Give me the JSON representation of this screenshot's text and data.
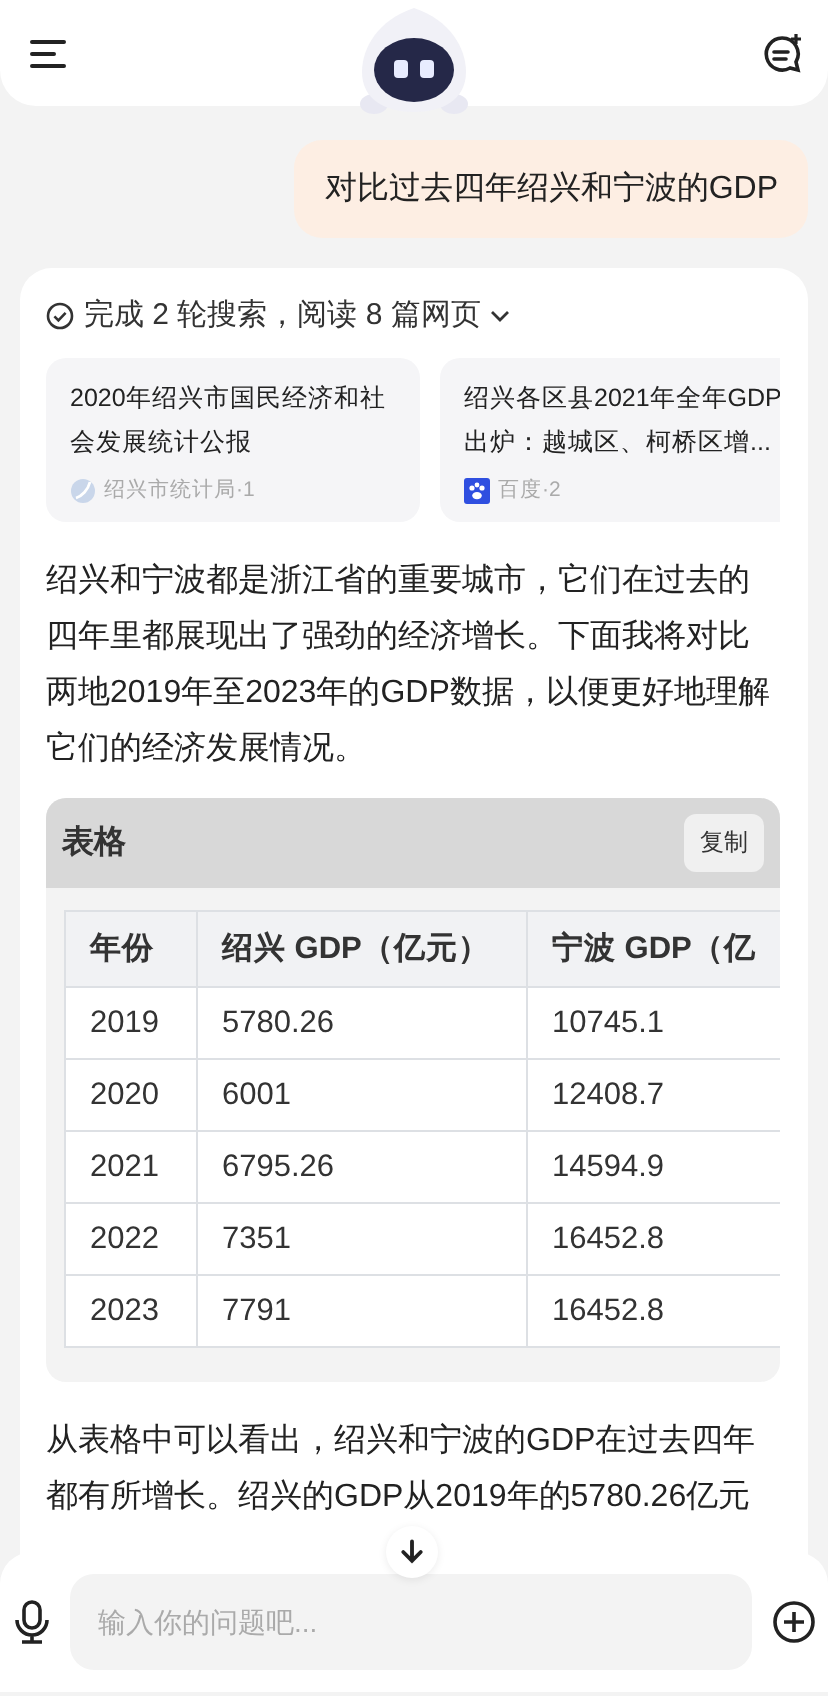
{
  "user_message": "对比过去四年绍兴和宁波的GDP",
  "answer": {
    "search_summary": "完成 2 轮搜索，阅读 8 篇网页",
    "sources": [
      {
        "title": "2020年绍兴市国民经济和社会发展统计公报",
        "source": "绍兴市统计局·1",
        "kind": "globe"
      },
      {
        "title": "绍兴各区县2021年全年GDP出炉：越城区、柯桥区增...",
        "source": "百度·2",
        "kind": "paw"
      }
    ],
    "intro": "绍兴和宁波都是浙江省的重要城市，它们在过去的四年里都展现出了强劲的经济增长。下面我将对比两地2019年至2023年的GDP数据，以便更好地理解它们的经济发展情况。",
    "table": {
      "title": "表格",
      "copy_button": "复制",
      "columns": [
        "年份",
        "绍兴 GDP（亿元）",
        "宁波 GDP（亿"
      ],
      "rows": [
        [
          "2019",
          "5780.26",
          "10745.1"
        ],
        [
          "2020",
          "6001",
          "12408.7"
        ],
        [
          "2021",
          "6795.26",
          "14594.9"
        ],
        [
          "2022",
          "7351",
          "16452.8"
        ],
        [
          "2023",
          "7791",
          "16452.8"
        ]
      ]
    },
    "conclusion": "从表格中可以看出，绍兴和宁波的GDP在过去四年都有所增长。绍兴的GDP从2019年的5780.26亿元"
  },
  "input": {
    "placeholder": "输入你的问题吧..."
  }
}
